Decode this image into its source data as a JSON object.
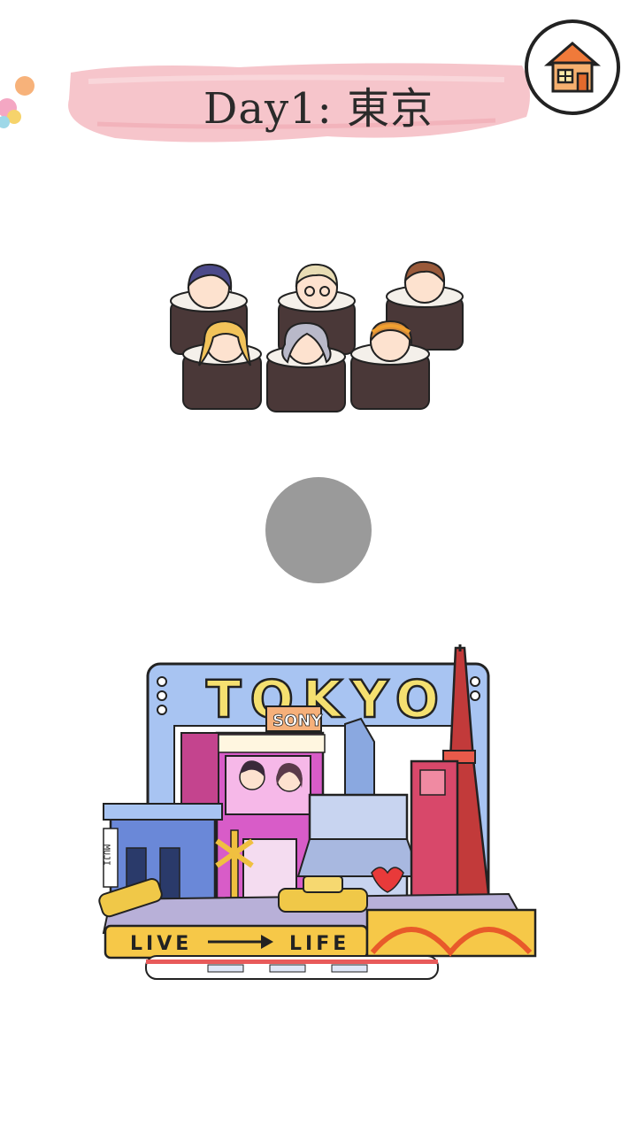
{
  "header": {
    "title": "Day1: 東京",
    "banner_color": "#f6c2c8"
  },
  "home_button": {
    "icon": "house-icon",
    "roof_color": "#f07a3a"
  },
  "illustration_top": {
    "icon": "sushi-roll-characters-illustration"
  },
  "record_button": {
    "color": "#9a9a9a"
  },
  "illustration_bottom": {
    "icon": "tokyo-cityscape-illustration",
    "sign_tokyo": "TOKYO",
    "sign_sony": "SONY",
    "sign_muji": "MUJI",
    "road_left": "LIVE",
    "road_right": "LIFE"
  }
}
